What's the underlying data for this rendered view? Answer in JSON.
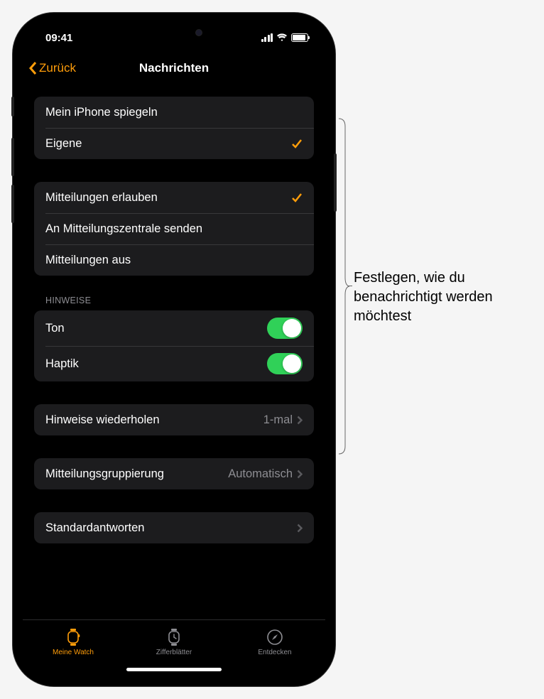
{
  "status": {
    "time": "09:41"
  },
  "nav": {
    "back": "Zurück",
    "title": "Nachrichten"
  },
  "mirror": {
    "opt_mirror": "Mein iPhone spiegeln",
    "opt_custom": "Eigene"
  },
  "notif": {
    "allow": "Mitteilungen erlauben",
    "send_center": "An Mitteilungszentrale senden",
    "off": "Mitteilungen aus"
  },
  "alerts": {
    "header": "HINWEISE",
    "sound": "Ton",
    "haptic": "Haptik"
  },
  "repeat": {
    "label": "Hinweise wiederholen",
    "value": "1-mal"
  },
  "grouping": {
    "label": "Mitteilungsgruppierung",
    "value": "Automatisch"
  },
  "replies": {
    "label": "Standardantworten"
  },
  "tabs": {
    "watch": "Meine Watch",
    "faces": "Zifferblätter",
    "discover": "Entdecken"
  },
  "callout": "Festlegen, wie du benachrichtigt werden möchtest"
}
